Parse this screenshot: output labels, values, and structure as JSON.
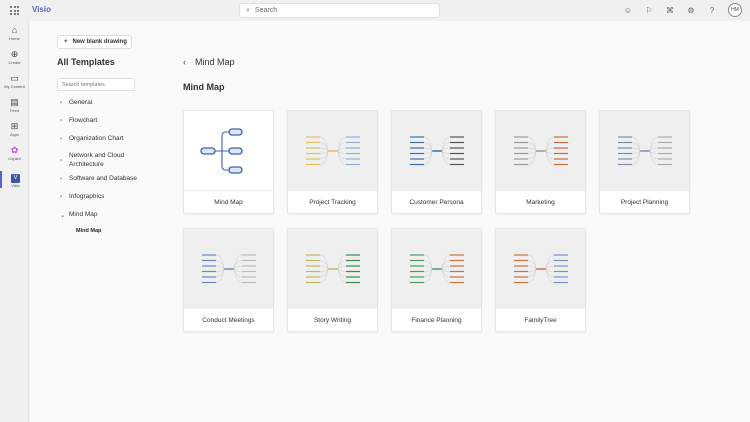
{
  "app": {
    "name": "Visio"
  },
  "search": {
    "placeholder": "Search"
  },
  "topbar": {
    "avatar": "HM",
    "icons": [
      "smiley-icon",
      "flag-icon",
      "megaphone-icon",
      "gear-icon",
      "help-icon"
    ]
  },
  "rail": [
    {
      "label": "Home",
      "icon": "home-icon"
    },
    {
      "label": "Create",
      "icon": "plus-circle-icon"
    },
    {
      "label": "My Content",
      "icon": "folder-icon"
    },
    {
      "label": "Feed",
      "icon": "feed-icon"
    },
    {
      "label": "Apps",
      "icon": "apps-icon"
    },
    {
      "label": "Copilot",
      "icon": "copilot-icon"
    },
    {
      "label": "Visio",
      "icon": "visio-icon"
    }
  ],
  "sidebar": {
    "new_blank": "New blank drawing",
    "title": "All Templates",
    "search_placeholder": "Search templates",
    "categories": [
      "General",
      "Flowchart",
      "Organization Chart",
      "Network and Cloud Architecture",
      "Software and Database",
      "Infographics",
      "Mind Map"
    ],
    "sub_item": "Mind Map"
  },
  "main": {
    "back_title": "Mind Map",
    "section_title": "Mind Map",
    "templates": [
      "Mind Map",
      "Project Tracking",
      "Customer Persona",
      "Marketing",
      "Project Planning",
      "Conduct Meetings",
      "Story Writing",
      "Finance Planning",
      "FamilyTree"
    ]
  },
  "colors": {
    "accent": "#5b5fc7"
  }
}
